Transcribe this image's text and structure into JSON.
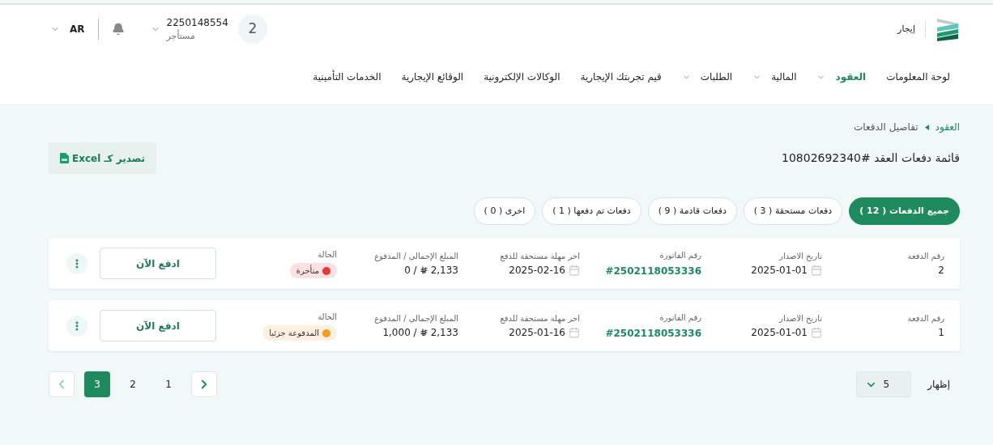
{
  "header": {
    "brand": "إيجار",
    "user": {
      "avatar": "2",
      "id": "2250148554",
      "role": "مستأجر"
    },
    "language": "AR"
  },
  "nav": [
    {
      "label": "لوحة المعلومات",
      "selected": false,
      "dropdown": false
    },
    {
      "label": "العقود",
      "selected": true,
      "dropdown": true
    },
    {
      "label": "المالية",
      "selected": false,
      "dropdown": true
    },
    {
      "label": "الطلبات",
      "selected": false,
      "dropdown": true
    },
    {
      "label": "قيم تجربتك الإيجارية",
      "selected": false,
      "dropdown": false
    },
    {
      "label": "الوكالات الإلكترونية",
      "selected": false,
      "dropdown": false
    },
    {
      "label": "الوقائع الإيجارية",
      "selected": false,
      "dropdown": false
    },
    {
      "label": "الخدمات التأمينية",
      "selected": false,
      "dropdown": false
    }
  ],
  "breadcrumb": [
    "العقود",
    "تفاصيل الدفعات"
  ],
  "title": "قائمة دفعات العقد #10802692340",
  "export_button": "تصدير كـ Excel",
  "filters": [
    {
      "label": "جميع الدفعات ( 12 )",
      "selected": true
    },
    {
      "label": "دفعات مستحقة ( 3 )",
      "selected": false
    },
    {
      "label": "دفعات قادمة ( 9 )",
      "selected": false
    },
    {
      "label": "دفعات تم دفعها ( 1 )",
      "selected": false
    },
    {
      "label": "اخرى ( 0 )",
      "selected": false
    }
  ],
  "payments": [
    {
      "labels": {
        "number": "رقم الدفعة",
        "issue_date": "تاريخ الاصدار",
        "invoice": "رقم الفاتورة",
        "due_date": "اخر مهلة مستحقة للدفع",
        "amount": "المبلغ الإجمالي / المدفوع",
        "status": "الحالة"
      },
      "number": "2",
      "issue_date": "2025-01-01",
      "invoice": "#2502118053336",
      "due_date": "2025-02-16",
      "total": "2,133",
      "paid": "/ 0",
      "status": {
        "label": "متأخرة",
        "color": "#e53935"
      },
      "action": "ادفع الآن"
    },
    {
      "labels": {
        "number": "رقم الدفعة",
        "issue_date": "تاريخ الاصدار",
        "invoice": "رقم الفاتورة",
        "due_date": "اخر مهلة مستحقة للدفع",
        "amount": "المبلغ الإجمالي / المدفوع",
        "status": "الحالة"
      },
      "number": "1",
      "issue_date": "2025-01-01",
      "invoice": "#2502118053336",
      "due_date": "2025-01-16",
      "total": "2,133",
      "paid": "/ 1,000",
      "status": {
        "label": "المدفوعة جزئيا",
        "color": "#f39c1f"
      },
      "action": "ادفع الآن"
    }
  ],
  "page_size": {
    "label": "إظهار",
    "value": "5"
  },
  "pagination": {
    "pages": [
      {
        "label": "1",
        "selected": false
      },
      {
        "label": "2",
        "selected": false
      },
      {
        "label": "3",
        "selected": true
      }
    ],
    "previous_enabled": true,
    "next_enabled": false
  }
}
